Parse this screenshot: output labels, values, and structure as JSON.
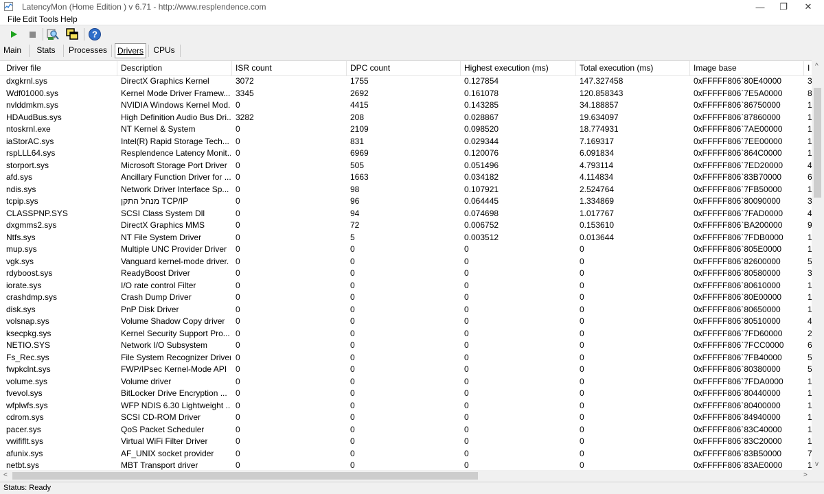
{
  "window": {
    "title": "LatencyMon  (Home Edition )  v 6.71 - http://www.resplendence.com",
    "minimize_glyph": "—",
    "maximize_glyph": "❐",
    "close_glyph": "✕"
  },
  "menu": [
    "File",
    "Edit",
    "Tools",
    "Help"
  ],
  "toolbar": {
    "icons": [
      "play-icon",
      "stop-icon",
      "drivers-search-icon",
      "windows-icon",
      "help-icon"
    ]
  },
  "tabs": [
    "Main",
    "Stats",
    "Processes",
    "Drivers",
    "CPUs"
  ],
  "active_tab": "Drivers",
  "table": {
    "columns": [
      "Driver file",
      "Description",
      "ISR count",
      "DPC count",
      "Highest execution (ms)",
      "Total execution (ms)",
      "Image base",
      "I"
    ],
    "rows": [
      [
        "dxgkrnl.sys",
        "DirectX Graphics Kernel",
        "3072",
        "1755",
        "0.127854",
        "147.327458",
        "0xFFFFF806`80E40000",
        "3"
      ],
      [
        "Wdf01000.sys",
        "Kernel Mode Driver Framew...",
        "3345",
        "2692",
        "0.161078",
        "120.858343",
        "0xFFFFF806`7E5A0000",
        "8"
      ],
      [
        "nvlddmkm.sys",
        "NVIDIA Windows Kernel Mod...",
        "0",
        "4415",
        "0.143285",
        "34.188857",
        "0xFFFFF806`86750000",
        "1"
      ],
      [
        "HDAudBus.sys",
        "High Definition Audio Bus Dri...",
        "3282",
        "208",
        "0.028867",
        "19.634097",
        "0xFFFFF806`87860000",
        "1"
      ],
      [
        "ntoskrnl.exe",
        "NT Kernel & System",
        "0",
        "2109",
        "0.098520",
        "18.774931",
        "0xFFFFF806`7AE00000",
        "1"
      ],
      [
        "iaStorAC.sys",
        "Intel(R) Rapid Storage Tech...",
        "0",
        "831",
        "0.029344",
        "7.169317",
        "0xFFFFF806`7EE00000",
        "1"
      ],
      [
        "rspLLL64.sys",
        "Resplendence Latency Monit...",
        "0",
        "6969",
        "0.120076",
        "6.091834",
        "0xFFFFF806`864C0000",
        "1"
      ],
      [
        "storport.sys",
        "Microsoft Storage Port Driver",
        "0",
        "505",
        "0.051496",
        "4.793114",
        "0xFFFFF806`7ED20000",
        "4"
      ],
      [
        "afd.sys",
        "Ancillary Function Driver for ...",
        "0",
        "1663",
        "0.034182",
        "4.114834",
        "0xFFFFF806`83B70000",
        "6"
      ],
      [
        "ndis.sys",
        "Network Driver Interface Sp...",
        "0",
        "98",
        "0.107921",
        "2.524764",
        "0xFFFFF806`7FB50000",
        "1"
      ],
      [
        "tcpip.sys",
        "מנהל התקן TCP/IP",
        "0",
        "96",
        "0.064445",
        "1.334869",
        "0xFFFFF806`80090000",
        "3"
      ],
      [
        "CLASSPNP.SYS",
        "SCSI Class System Dll",
        "0",
        "94",
        "0.074698",
        "1.017767",
        "0xFFFFF806`7FAD0000",
        "4"
      ],
      [
        "dxgmms2.sys",
        "DirectX Graphics MMS",
        "0",
        "72",
        "0.006752",
        "0.153610",
        "0xFFFFF806`BA200000",
        "9"
      ],
      [
        "Ntfs.sys",
        "NT File System Driver",
        "0",
        "5",
        "0.003512",
        "0.013644",
        "0xFFFFF806`7FDB0000",
        "1"
      ],
      [
        "mup.sys",
        "Multiple UNC Provider Driver",
        "0",
        "0",
        "0",
        "0",
        "0xFFFFF806`805E0000",
        "1"
      ],
      [
        "vgk.sys",
        "Vanguard kernel-mode driver.",
        "0",
        "0",
        "0",
        "0",
        "0xFFFFF806`82600000",
        "5"
      ],
      [
        "rdyboost.sys",
        "ReadyBoost Driver",
        "0",
        "0",
        "0",
        "0",
        "0xFFFFF806`80580000",
        "3"
      ],
      [
        "iorate.sys",
        "I/O rate control Filter",
        "0",
        "0",
        "0",
        "0",
        "0xFFFFF806`80610000",
        "1"
      ],
      [
        "crashdmp.sys",
        "Crash Dump Driver",
        "0",
        "0",
        "0",
        "0",
        "0xFFFFF806`80E00000",
        "1"
      ],
      [
        "disk.sys",
        "PnP Disk Driver",
        "0",
        "0",
        "0",
        "0",
        "0xFFFFF806`80650000",
        "1"
      ],
      [
        "volsnap.sys",
        "Volume Shadow Copy driver",
        "0",
        "0",
        "0",
        "0",
        "0xFFFFF806`80510000",
        "4"
      ],
      [
        "ksecpkg.sys",
        "Kernel Security Support Pro...",
        "0",
        "0",
        "0",
        "0",
        "0xFFFFF806`7FD60000",
        "2"
      ],
      [
        "NETIO.SYS",
        "Network I/O Subsystem",
        "0",
        "0",
        "0",
        "0",
        "0xFFFFF806`7FCC0000",
        "6"
      ],
      [
        "Fs_Rec.sys",
        "File System Recognizer Driver",
        "0",
        "0",
        "0",
        "0",
        "0xFFFFF806`7FB40000",
        "5"
      ],
      [
        "fwpkclnt.sys",
        "FWP/IPsec Kernel-Mode API",
        "0",
        "0",
        "0",
        "0",
        "0xFFFFF806`80380000",
        "5"
      ],
      [
        "volume.sys",
        "Volume driver",
        "0",
        "0",
        "0",
        "0",
        "0xFFFFF806`7FDA0000",
        "1"
      ],
      [
        "fvevol.sys",
        "BitLocker Drive Encryption ...",
        "0",
        "0",
        "0",
        "0",
        "0xFFFFF806`80440000",
        "1"
      ],
      [
        "wfplwfs.sys",
        "WFP NDIS 6.30 Lightweight ...",
        "0",
        "0",
        "0",
        "0",
        "0xFFFFF806`80400000",
        "1"
      ],
      [
        "cdrom.sys",
        "SCSI CD-ROM Driver",
        "0",
        "0",
        "0",
        "0",
        "0xFFFFF806`84940000",
        "1"
      ],
      [
        "pacer.sys",
        "QoS Packet Scheduler",
        "0",
        "0",
        "0",
        "0",
        "0xFFFFF806`83C40000",
        "1"
      ],
      [
        "vwififlt.sys",
        "Virtual WiFi Filter Driver",
        "0",
        "0",
        "0",
        "0",
        "0xFFFFF806`83C20000",
        "1"
      ],
      [
        "afunix.sys",
        "AF_UNIX socket provider",
        "0",
        "0",
        "0",
        "0",
        "0xFFFFF806`83B50000",
        "7"
      ],
      [
        "netbt.sys",
        "MBT Transport driver",
        "0",
        "0",
        "0",
        "0",
        "0xFFFFF806`83AE0000",
        "1"
      ]
    ]
  },
  "scrollbar": {
    "left_arrow": "<",
    "right_arrow": ">",
    "up_arrow": "^",
    "down_arrow": "v"
  },
  "status": "Status: Ready"
}
